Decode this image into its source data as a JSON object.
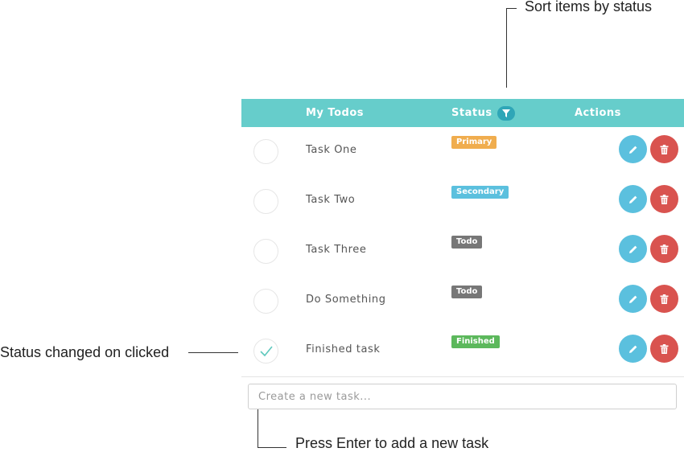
{
  "annotations": {
    "sort": "Sort items by status",
    "status_changed": "Status changed on clicked",
    "press_enter": "Press Enter to add a new task"
  },
  "header": {
    "col_todos": "My Todos",
    "col_status": "Status",
    "col_actions": "Actions",
    "filter_icon": "filter-icon"
  },
  "tasks": [
    {
      "name": "Task One",
      "status": "Primary",
      "done": false
    },
    {
      "name": "Task Two",
      "status": "Secondary",
      "done": false
    },
    {
      "name": "Task Three",
      "status": "Todo",
      "done": false
    },
    {
      "name": "Do Something",
      "status": "Todo",
      "done": false
    },
    {
      "name": "Finished task",
      "status": "Finished",
      "done": true
    }
  ],
  "new_task": {
    "placeholder": "Create a new task...",
    "value": ""
  },
  "colors": {
    "header": "#66cdcb",
    "primary": "#f0ad4e",
    "secondary": "#5bc0de",
    "todo": "#777777",
    "finished": "#5cb85c",
    "edit": "#5bc0de",
    "delete": "#d9534f"
  }
}
